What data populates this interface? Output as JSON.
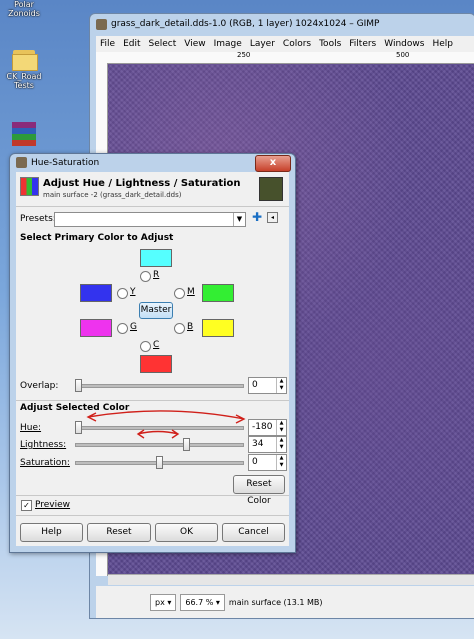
{
  "desktop": {
    "icons": [
      {
        "label_line1": "Polar",
        "label_line2": "Zonoids"
      },
      {
        "label_line1": "CK_Road",
        "label_line2": "Tests"
      }
    ]
  },
  "gimp": {
    "title": "grass_dark_detail.dds-1.0 (RGB, 1 layer) 1024x1024 – GIMP",
    "menu": [
      "File",
      "Edit",
      "Select",
      "View",
      "Image",
      "Layer",
      "Colors",
      "Tools",
      "Filters",
      "Windows",
      "Help"
    ],
    "ruler_marks": [
      "250",
      "500"
    ],
    "status": {
      "unit": "px",
      "zoom": "66.7 %",
      "info": "main surface (13.1 MB)"
    }
  },
  "dialog": {
    "title": "Hue-Saturation",
    "close": "x",
    "header_title": "Adjust Hue / Lightness / Saturation",
    "header_subtitle": "main surface -2 (grass_dark_detail.dds)",
    "presets_label": "Presets:",
    "primary_heading": "Select Primary Color to Adjust",
    "colors": {
      "R": {
        "label": "R",
        "color": "#ff3333"
      },
      "Y": {
        "label": "Y",
        "color": "#3333ee"
      },
      "M": {
        "label": "M",
        "color": "#33ee33"
      },
      "G": {
        "label": "G",
        "color": "#ee33ee"
      },
      "B": {
        "label": "B",
        "color": "#ffff22"
      },
      "C": {
        "label": "C",
        "color": "#ff3333"
      },
      "R_swatch": "#55ffff"
    },
    "master_label": "Master",
    "overlap": {
      "label": "Overlap:",
      "value": "0",
      "level": 0
    },
    "adjust_heading": "Adjust Selected Color",
    "hue": {
      "label": "Hue:",
      "value": "-180",
      "level": 0
    },
    "lightness": {
      "label": "Lightness:",
      "value": "34",
      "level": 0.67
    },
    "saturation": {
      "label": "Saturation:",
      "value": "0",
      "level": 0.5
    },
    "reset_color_label": "Reset Color",
    "preview_label": "Preview",
    "preview_checked": true,
    "buttons": {
      "help": "Help",
      "reset": "Reset",
      "ok": "OK",
      "cancel": "Cancel"
    }
  }
}
